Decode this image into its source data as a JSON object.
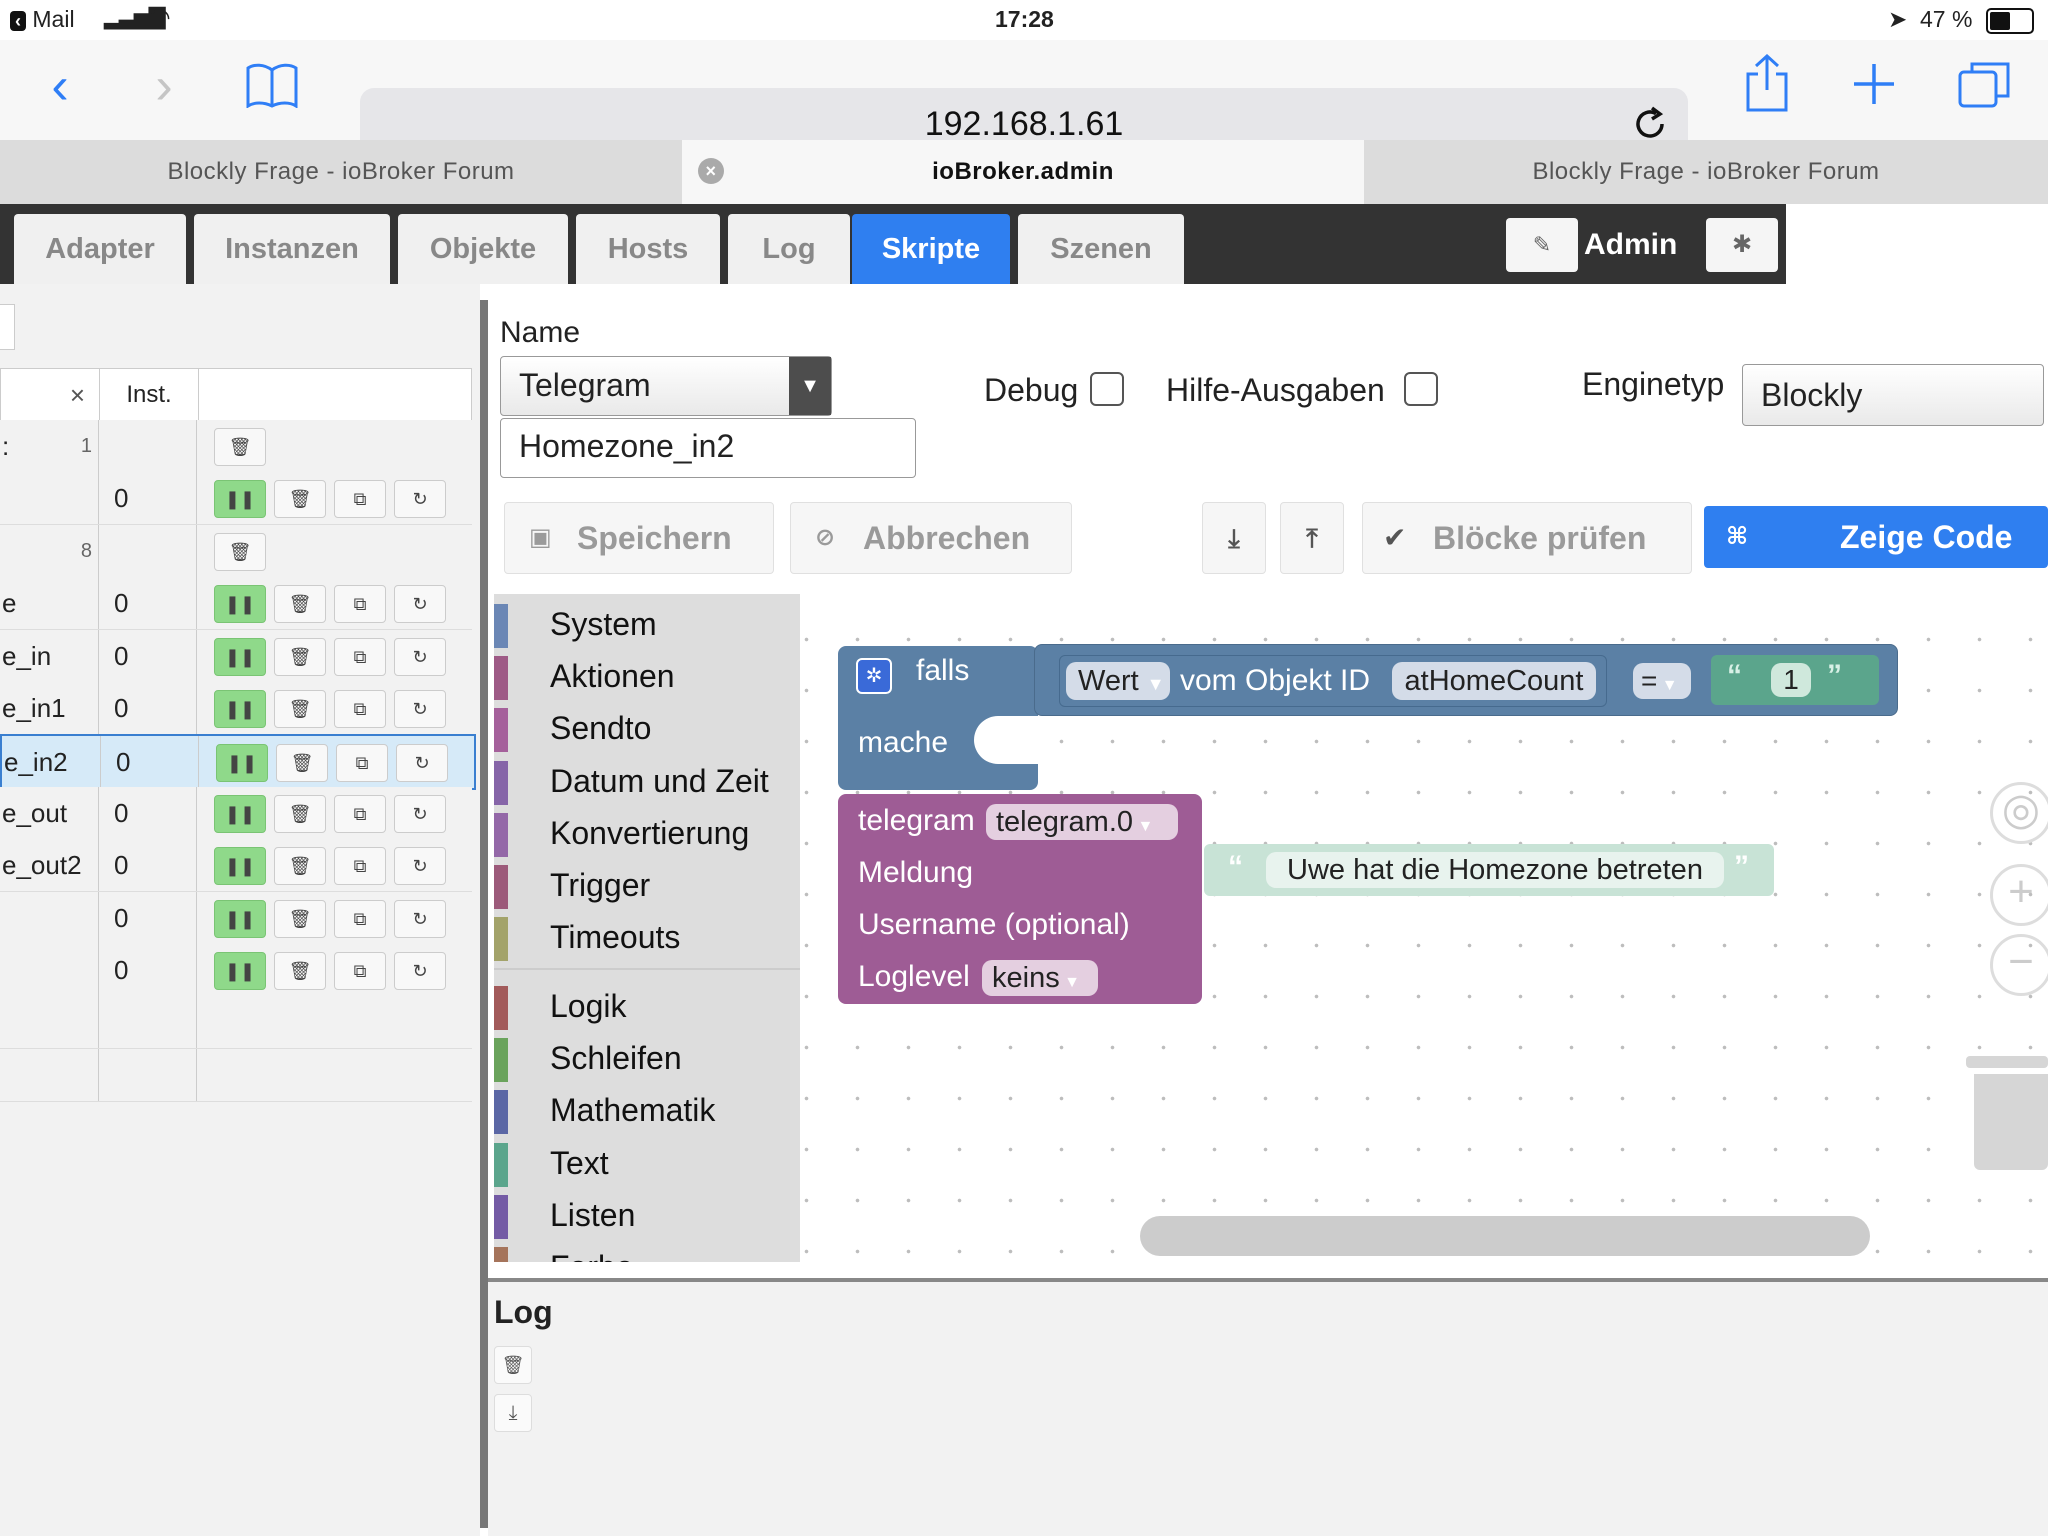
{
  "status_bar": {
    "back_app": "Mail",
    "time": "17:28",
    "battery": "47 %"
  },
  "safari": {
    "url": "192.168.1.61",
    "tabs": [
      {
        "label": "Blockly Frage - ioBroker Forum"
      },
      {
        "label": "ioBroker.admin"
      },
      {
        "label": "Blockly Frage - ioBroker Forum"
      }
    ]
  },
  "nav": {
    "tabs": [
      "Adapter",
      "Instanzen",
      "Objekte",
      "Hosts",
      "Log",
      "Skripte",
      "Szenen"
    ],
    "user": "Admin"
  },
  "scripts_table": {
    "col_close": "×",
    "col_inst": "Inst.",
    "rows": [
      {
        "name": ":",
        "id": "1",
        "inst": "",
        "type": "folder"
      },
      {
        "name": "",
        "id": "",
        "inst": "0",
        "type": "script"
      },
      {
        "name": "",
        "id": "8",
        "inst": "",
        "type": "folder"
      },
      {
        "name": "e",
        "id": "",
        "inst": "0",
        "type": "script"
      },
      {
        "name": "e_in",
        "id": "",
        "inst": "0",
        "type": "script"
      },
      {
        "name": "e_in1",
        "id": "",
        "inst": "0",
        "type": "script"
      },
      {
        "name": "e_in2",
        "id": "",
        "inst": "0",
        "type": "script",
        "selected": true
      },
      {
        "name": "e_out",
        "id": "",
        "inst": "0",
        "type": "script"
      },
      {
        "name": "e_out2",
        "id": "",
        "inst": "0",
        "type": "script"
      },
      {
        "name": "",
        "id": "",
        "inst": "0",
        "type": "script"
      },
      {
        "name": "",
        "id": "",
        "inst": "0",
        "type": "script"
      },
      {
        "name": "",
        "id": "",
        "inst": "",
        "type": "empty"
      },
      {
        "name": "",
        "id": "",
        "inst": "",
        "type": "empty"
      }
    ]
  },
  "editor": {
    "name_label": "Name",
    "folder_select": "Telegram",
    "script_name": "Homezone_in2",
    "debug_label": "Debug",
    "help_label": "Hilfe-Ausgaben",
    "engine_label": "Enginetyp",
    "engine_value": "Blockly",
    "buttons": {
      "save": "Speichern",
      "cancel": "Abbrechen",
      "check": "Blöcke prüfen",
      "show_code": "Zeige Code"
    }
  },
  "toolbox": {
    "group1": [
      {
        "label": "System",
        "color": "#6b87b5"
      },
      {
        "label": "Aktionen",
        "color": "#9e5a86"
      },
      {
        "label": "Sendto",
        "color": "#a5609b"
      },
      {
        "label": "Datum und Zeit",
        "color": "#8665a8"
      },
      {
        "label": "Konvertierung",
        "color": "#9468a8"
      },
      {
        "label": "Trigger",
        "color": "#9c5a7a"
      },
      {
        "label": "Timeouts",
        "color": "#a3a36a"
      }
    ],
    "group2": [
      {
        "label": "Logik",
        "color": "#a25a5a"
      },
      {
        "label": "Schleifen",
        "color": "#6aa35c"
      },
      {
        "label": "Mathematik",
        "color": "#5b67a5"
      },
      {
        "label": "Text",
        "color": "#5ba58c"
      },
      {
        "label": "Listen",
        "color": "#745ba5"
      },
      {
        "label": "Farbe",
        "color": "#a5745b"
      }
    ]
  },
  "blocks": {
    "if_label": "falls",
    "do_label": "mache",
    "value_dropdown": "Wert",
    "from_object": "vom Objekt ID",
    "object_id": "atHomeCount",
    "operator": "=",
    "compare_value": "1",
    "telegram_label": "telegram",
    "telegram_instance": "telegram.0",
    "message_label": "Meldung",
    "message_text": "Uwe hat die Homezone betreten",
    "username_label": "Username (optional)",
    "loglevel_label": "Loglevel",
    "loglevel_value": "keins"
  },
  "log_panel": {
    "title": "Log"
  }
}
